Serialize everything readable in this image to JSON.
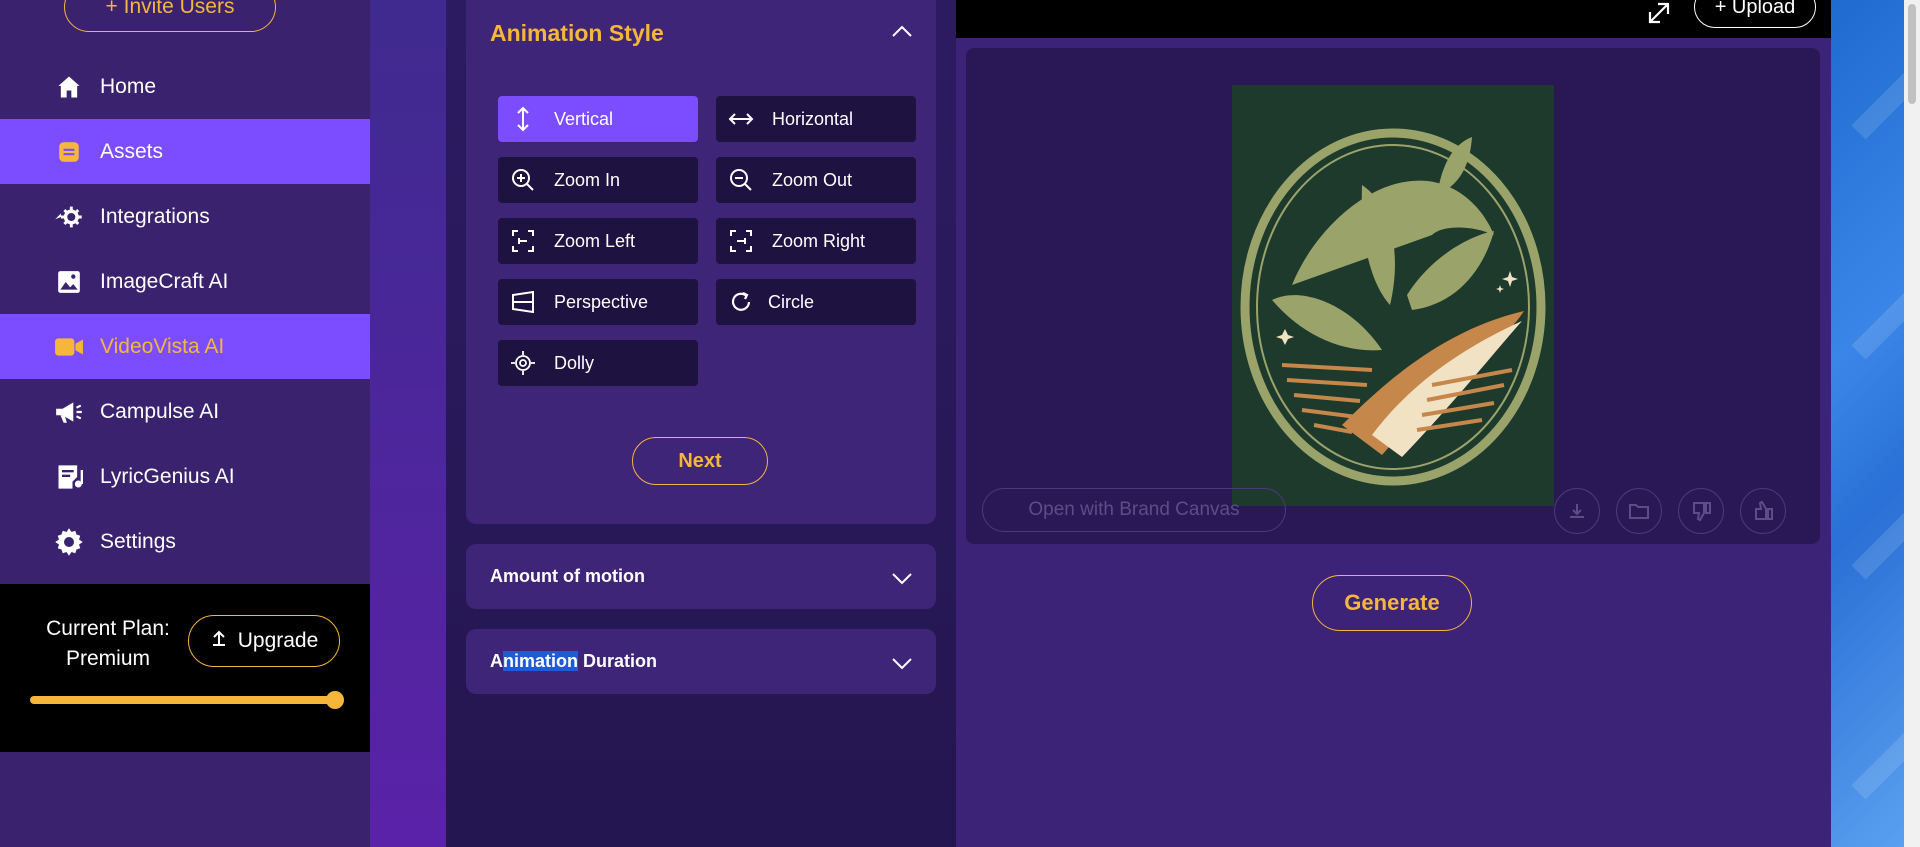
{
  "sidebar": {
    "invite_label": "+ Invite Users",
    "items": [
      {
        "label": "Home",
        "icon": "home-icon"
      },
      {
        "label": "Assets",
        "icon": "assets-icon"
      },
      {
        "label": "Integrations",
        "icon": "integrations-icon"
      },
      {
        "label": "ImageCraft AI",
        "icon": "image-icon"
      },
      {
        "label": "VideoVista AI",
        "icon": "video-icon"
      },
      {
        "label": "Campulse AI",
        "icon": "megaphone-icon"
      },
      {
        "label": "LyricGenius AI",
        "icon": "lyrics-icon"
      },
      {
        "label": "Settings",
        "icon": "gear-icon"
      }
    ],
    "plan_label": "Current Plan: Premium",
    "upgrade_label": "Upgrade",
    "plan_usage_fraction": 1.0
  },
  "animation_style": {
    "title": "Animation Style",
    "options": [
      {
        "label": "Vertical",
        "icon": "vertical-arrows-icon"
      },
      {
        "label": "Horizontal",
        "icon": "horizontal-arrows-icon"
      },
      {
        "label": "Zoom In",
        "icon": "zoom-in-icon"
      },
      {
        "label": "Zoom Out",
        "icon": "zoom-out-icon"
      },
      {
        "label": "Zoom Left",
        "icon": "zoom-left-icon"
      },
      {
        "label": "Zoom Right",
        "icon": "zoom-right-icon"
      },
      {
        "label": "Perspective",
        "icon": "perspective-icon"
      },
      {
        "label": "Circle",
        "icon": "circle-arrow-icon"
      },
      {
        "label": "Dolly",
        "icon": "dolly-icon"
      }
    ],
    "selected": "Vertical",
    "next_label": "Next"
  },
  "amount_of_motion": {
    "title": "Amount of motion"
  },
  "animation_duration": {
    "title_a": "A",
    "title_sel": "nimation",
    "title_rest": " Duration"
  },
  "preview": {
    "upload_label": "+ Upload",
    "brand_canvas_label": "Open with Brand Canvas",
    "generate_label": "Generate"
  },
  "colors": {
    "accent": "#7c4dff",
    "gold": "#f5b63a",
    "bg": "#2a1a5a"
  }
}
